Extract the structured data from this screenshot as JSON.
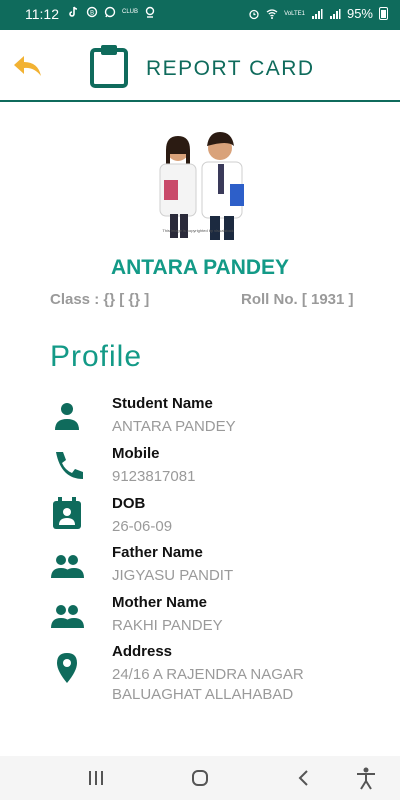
{
  "status_bar": {
    "time": "11:12",
    "left_icons": [
      "tiktok-icon",
      "whatsapp-business-icon",
      "whatsapp-icon",
      "club-icon",
      "location-icon"
    ],
    "club_text": "CLUB",
    "carrier": "VoLTE1",
    "battery": "95%"
  },
  "header": {
    "title": "REPORT CARD",
    "accent": "#0f6b5c",
    "back_icon_color": "#f2b233"
  },
  "student": {
    "name": "ANTARA PANDEY",
    "class_text": "Class : {} [ {} ]",
    "roll_text": "Roll No. [ 1931 ]",
    "photo_caption": "This image is copyrighted by visualstock"
  },
  "profile": {
    "heading": "Profile",
    "items": [
      {
        "icon": "person-icon",
        "label": "Student Name",
        "value": "ANTARA PANDEY"
      },
      {
        "icon": "phone-icon",
        "label": "Mobile",
        "value": "9123817081"
      },
      {
        "icon": "calendar-icon",
        "label": "DOB",
        "value": "26-06-09"
      },
      {
        "icon": "people-icon",
        "label": "Father Name",
        "value": "JIGYASU PANDIT"
      },
      {
        "icon": "people-icon",
        "label": "Mother Name",
        "value": "RAKHI PANDEY"
      },
      {
        "icon": "location-pin-icon",
        "label": "Address",
        "value": "24/16 A RAJENDRA NAGAR BALUAGHAT ALLAHABAD"
      }
    ]
  },
  "nav": [
    "recent-apps-icon",
    "home-icon",
    "back-icon",
    "accessibility-icon"
  ]
}
